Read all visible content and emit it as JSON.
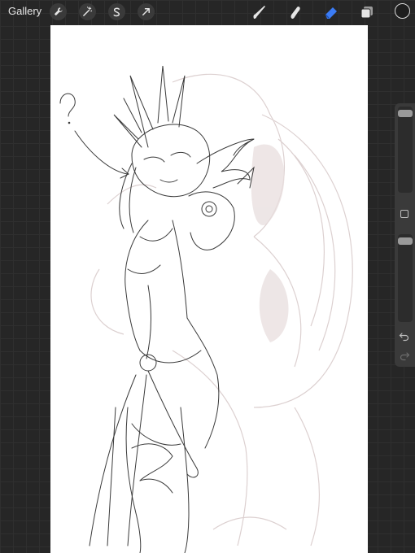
{
  "topbar": {
    "gallery_label": "Gallery",
    "left_tools": [
      "wrench-icon",
      "magic-wand-icon",
      "selection-icon",
      "transform-arrow-icon"
    ],
    "right_tools": [
      "brush-icon",
      "smudge-icon",
      "eraser-icon",
      "layers-icon"
    ],
    "active_tool": "eraser-icon",
    "accent_color": "#3b7cf5",
    "current_color": "#1e1e1e"
  },
  "sidebar": {
    "brush_size_level": 0.05,
    "opacity_level": 0.05
  }
}
